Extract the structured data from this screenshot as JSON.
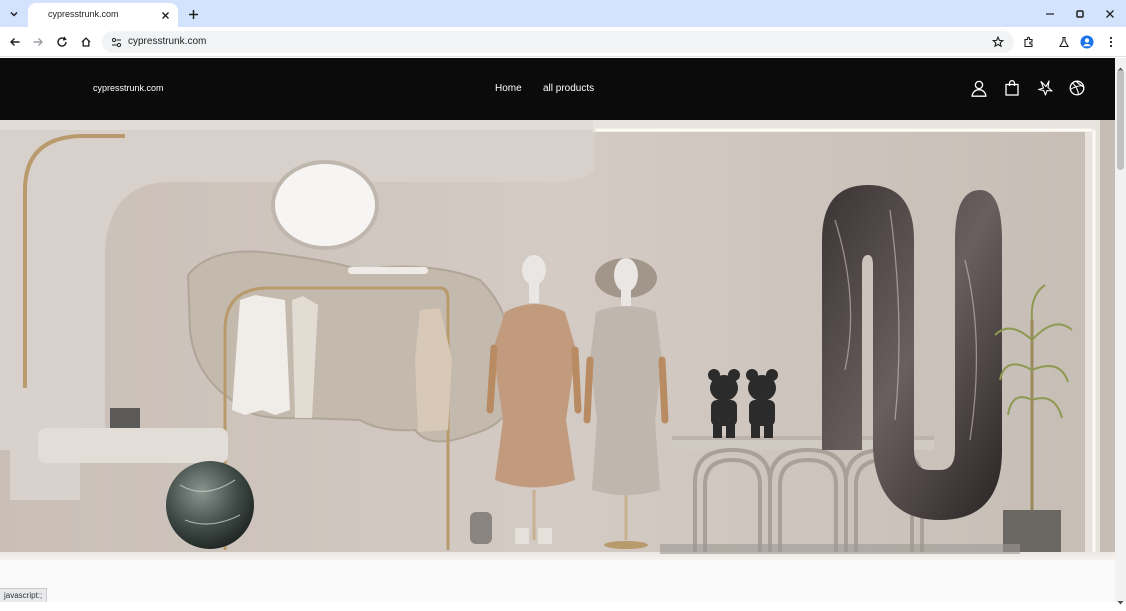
{
  "browser": {
    "tab": {
      "title": "cypresstrunk.com"
    },
    "url": "cypresstrunk.com",
    "status_text": "javascript:;"
  },
  "site": {
    "brand": "cypresstrunk.com",
    "nav": {
      "home": "Home",
      "all_products": "all products"
    }
  },
  "hero": {
    "description": "Store interior with mannequins, clothing rack, marble sphere, bear figurines, and U-shaped marble sculpture"
  },
  "colors": {
    "tabbar_bg": "#d3e3fd",
    "header_bg": "#0b0b0b",
    "hero_wall": "#cfc7c0"
  }
}
